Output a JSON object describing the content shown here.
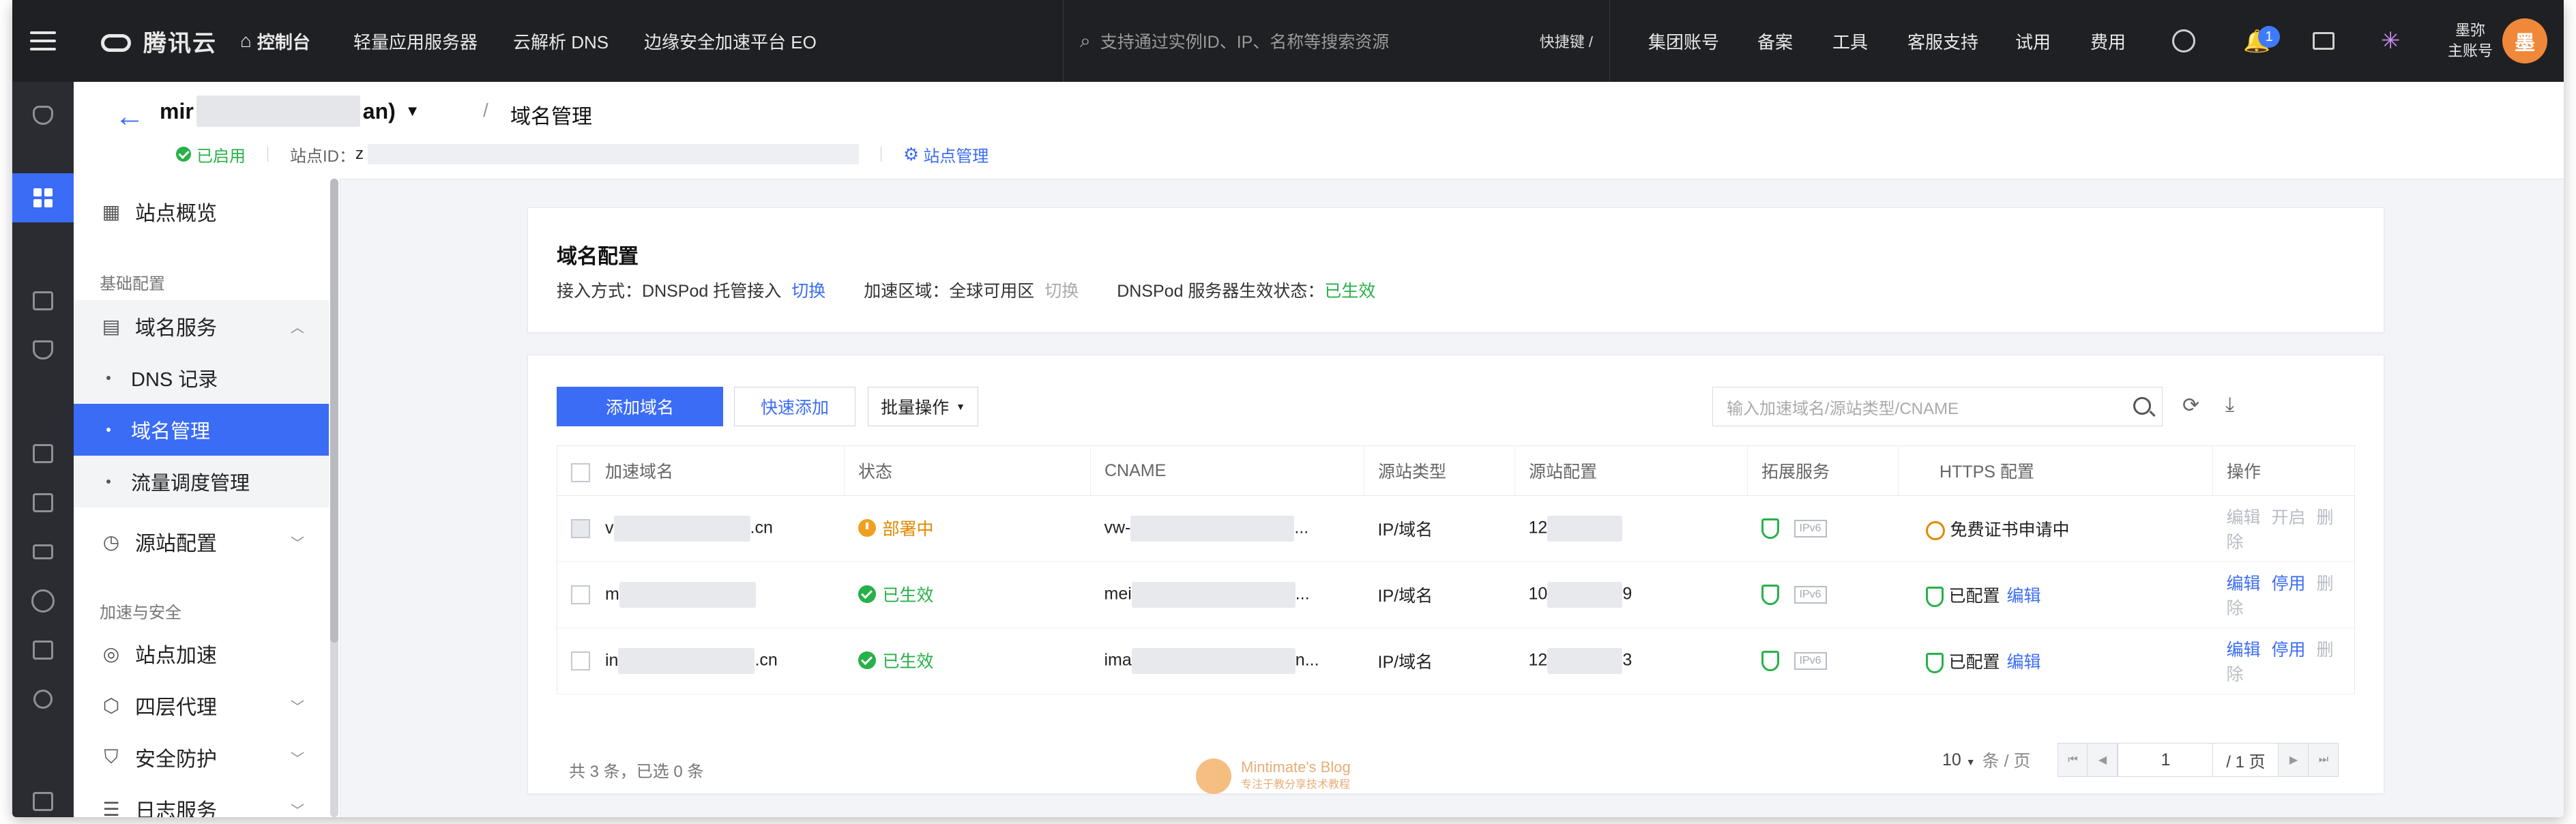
{
  "topbar": {
    "brand": "腾讯云",
    "console": "控制台",
    "nav": [
      "轻量应用服务器",
      "云解析 DNS",
      "边缘安全加速平台 EO"
    ],
    "search_placeholder": "支持通过实例ID、IP、名称等搜索资源",
    "shortcut": "快捷键 /",
    "links": [
      "集团账号",
      "备案",
      "工具",
      "客服支持",
      "试用",
      "费用"
    ],
    "notify_count": "1",
    "user_name": "墨弥",
    "user_role": "主账号",
    "avatar_text": "墨"
  },
  "header": {
    "site_prefix": "mir",
    "site_suffix": "an)",
    "crumb": "域名管理",
    "status": "已启用",
    "site_id_label": "站点ID：",
    "site_id_value": "z",
    "site_manage": "站点管理"
  },
  "sidebar": {
    "overview": "站点概览",
    "group_basic": "基础配置",
    "domain_service": "域名服务",
    "dns_records": "DNS 记录",
    "domain_manage": "域名管理",
    "traffic": "流量调度管理",
    "origin_config": "源站配置",
    "group_accel": "加速与安全",
    "site_accel": "站点加速",
    "l4_proxy": "四层代理",
    "security": "安全防护",
    "logs": "日志服务"
  },
  "domain_config": {
    "title": "域名配置",
    "access_label": "接入方式：",
    "access_value": "DNSPod 托管接入",
    "access_switch": "切换",
    "region_label": "加速区域：",
    "region_value": "全球可用区",
    "region_switch": "切换",
    "dns_status_label": "DNSPod 服务器生效状态：",
    "dns_status_value": "已生效"
  },
  "toolbar": {
    "add_domain": "添加域名",
    "quick_add": "快速添加",
    "batch": "批量操作",
    "search_placeholder": "输入加速域名/源站类型/CNAME"
  },
  "table": {
    "headers": [
      "加速域名",
      "状态",
      "CNAME",
      "源站类型",
      "源站配置",
      "拓展服务",
      "HTTPS 配置",
      "操作"
    ],
    "rows": [
      {
        "domain_pre": "v",
        "domain_suf": ".cn",
        "status": "部署中",
        "cname": "vw-",
        "cname_tail": "...",
        "origin_type": "IP/域名",
        "origin_pre": "12",
        "origin_suf": "",
        "ipv6": "IPv6",
        "https": "免费证书申请中",
        "https_edit": "",
        "op1": "编辑",
        "op2": "开启",
        "op3": "删除"
      },
      {
        "domain_pre": "m",
        "domain_suf": "",
        "status": "已生效",
        "cname": "mei",
        "cname_tail": "...",
        "origin_type": "IP/域名",
        "origin_pre": "10",
        "origin_suf": "9",
        "ipv6": "IPv6",
        "https": "已配置",
        "https_edit": "编辑",
        "op1": "编辑",
        "op2": "停用",
        "op3": "删除"
      },
      {
        "domain_pre": "in",
        "domain_suf": ".cn",
        "status": "已生效",
        "cname": "ima",
        "cname_tail": "n...",
        "origin_type": "IP/域名",
        "origin_pre": "12",
        "origin_suf": "3",
        "ipv6": "IPv6",
        "https": "已配置",
        "https_edit": "编辑",
        "op1": "编辑",
        "op2": "停用",
        "op3": "删除"
      }
    ]
  },
  "footer": {
    "summary": "共 3 条，已选 0 条",
    "page_size": "10",
    "page_size_unit": "条 / 页",
    "page": "1",
    "total_pages": "/ 1 页"
  },
  "watermark": {
    "title": "Mintimate's Blog",
    "subtitle": "专注于教分享技术教程"
  }
}
